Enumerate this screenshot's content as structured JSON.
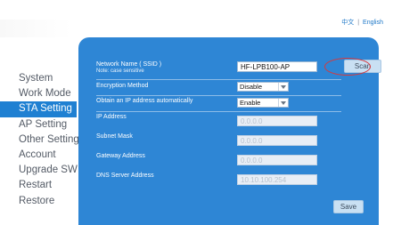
{
  "language": {
    "chinese_label": "中文",
    "separator": "|",
    "english_label": "English"
  },
  "sidebar": {
    "items": [
      {
        "label": "System"
      },
      {
        "label": "Work Mode"
      },
      {
        "label": "STA Setting"
      },
      {
        "label": "AP Setting"
      },
      {
        "label": "Other Setting"
      },
      {
        "label": "Account"
      },
      {
        "label": "Upgrade SW"
      },
      {
        "label": "Restart"
      },
      {
        "label": "Restore"
      }
    ],
    "active_index": 2
  },
  "form": {
    "ssid": {
      "label": "Network Name ( SSID )",
      "note": "Note: case sensitive",
      "value": "HF-LPB100-AP",
      "scan_label": "Scan"
    },
    "encryption": {
      "label": "Encryption Method",
      "value": "Disable"
    },
    "dhcp": {
      "label": "Obtain an IP address automatically",
      "value": "Enable"
    },
    "ip_address": {
      "label": "IP Address",
      "value": "0.0.0.0"
    },
    "subnet_mask": {
      "label": "Subnet Mask",
      "value": "0.0.0.0"
    },
    "gateway": {
      "label": "Gateway Address",
      "value": "0.0.0.0"
    },
    "dns": {
      "label": "DNS Server Address",
      "value": "10.10.100.254"
    },
    "save_label": "Save"
  },
  "colors": {
    "panel": "#2e86d5",
    "active_nav": "#1f80d2",
    "highlight_circle": "#d5393d"
  },
  "icons": {
    "select_arrow": "chevron-down-icon"
  }
}
